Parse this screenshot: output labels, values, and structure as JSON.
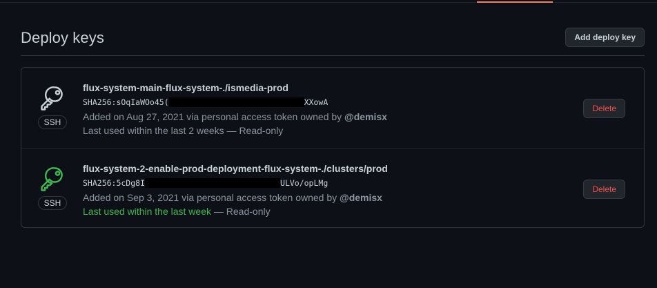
{
  "header": {
    "title": "Deploy keys",
    "add_button": "Add deploy key"
  },
  "colors": {
    "accent_tab": "#f78166",
    "key_icon_default": "#c9d1d9",
    "key_icon_recent": "#3fb950",
    "danger": "#f85149"
  },
  "keys": [
    {
      "icon": "key-icon",
      "badge": "SSH",
      "title": "flux-system-main-flux-system-./ismedia-prod",
      "fingerprint_start": "SHA256:sOqIaWOo45(",
      "fingerprint_end": "XXowA",
      "added_prefix": "Added on Aug 27, 2021 via personal access token owned by ",
      "owner": "@demisx",
      "last_used": "Last used within the last 2 weeks",
      "access": " — Read-only",
      "delete_label": "Delete"
    },
    {
      "icon": "key-icon",
      "badge": "SSH",
      "title": "flux-system-2-enable-prod-deployment-flux-system-./clusters/prod",
      "fingerprint_start": "SHA256:5cDg8I",
      "fingerprint_end": "ULVo/opLMg",
      "added_prefix": "Added on Sep 3, 2021 via personal access token owned by ",
      "owner": "@demisx",
      "last_used": "Last used within the last week",
      "access": " — Read-only",
      "delete_label": "Delete"
    }
  ]
}
